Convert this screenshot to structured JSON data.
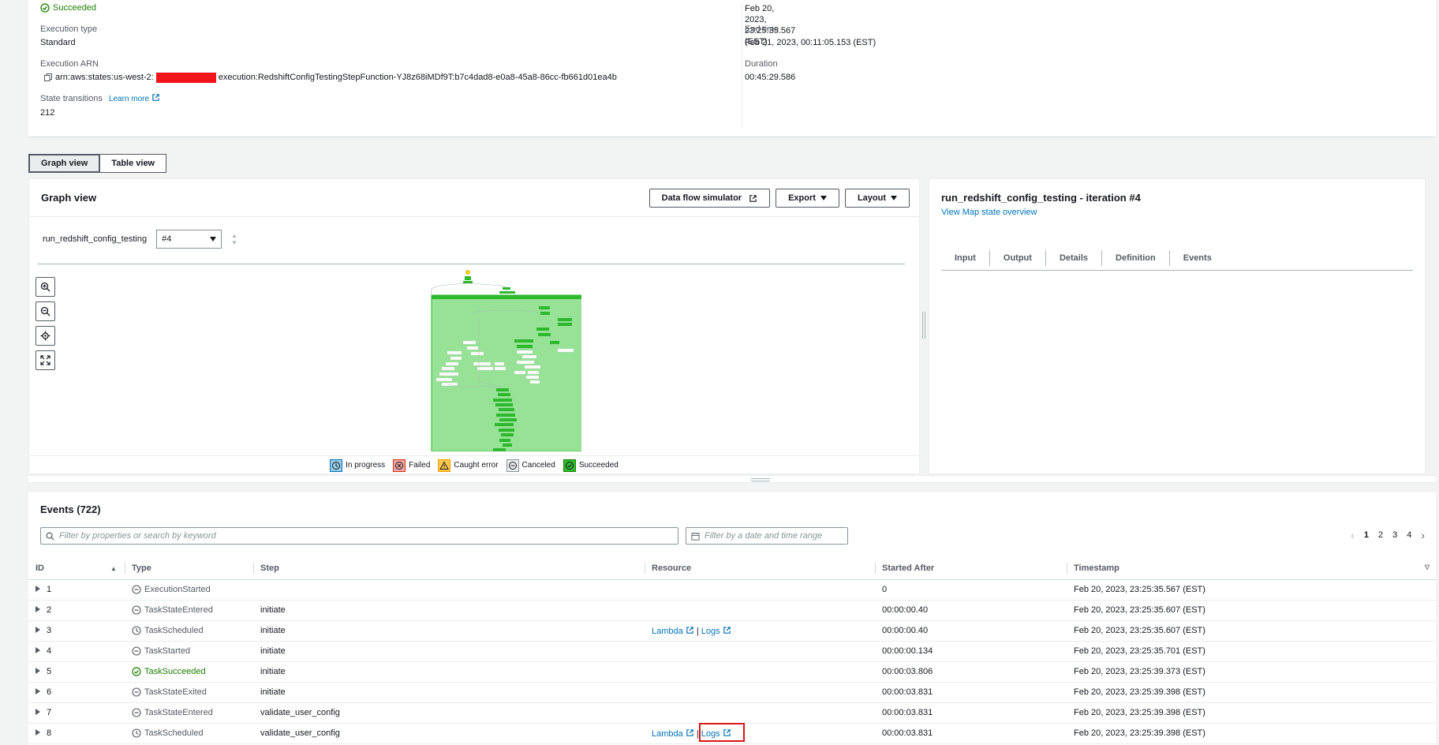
{
  "summary": {
    "status": "Succeeded",
    "start_time": "Feb 20, 2023, 23:25:35.567 (EST)",
    "execution_type_label": "Execution type",
    "execution_type": "Standard",
    "end_time_label": "End time",
    "end_time": "Feb 21, 2023, 00:11:05.153 (EST)",
    "arn_label": "Execution ARN",
    "arn_prefix": "arn:aws:states:us-west-2:",
    "arn_suffix": "execution:RedshiftConfigTestingStepFunction-YJ8z68iMDf9T:b7c4dad8-e0a8-45a8-86cc-fb661d01ea4b",
    "duration_label": "Duration",
    "duration": "00:45:29.586",
    "state_transitions_label": "State transitions",
    "learn_more": "Learn more",
    "state_transitions": "212"
  },
  "view_tabs": [
    "Graph view",
    "Table view"
  ],
  "graph": {
    "title": "Graph view",
    "data_flow_button": "Data flow simulator",
    "export_button": "Export",
    "layout_button": "Layout",
    "map_state_label": "run_redshift_config_testing",
    "iteration_value": "#4",
    "legend": [
      "In progress",
      "Failed",
      "Caught error",
      "Canceled",
      "Succeeded"
    ]
  },
  "detail": {
    "title": "run_redshift_config_testing - iteration #4",
    "link": "View Map state overview",
    "tabs": [
      "Input",
      "Output",
      "Details",
      "Definition",
      "Events"
    ]
  },
  "events": {
    "title": "Events (722)",
    "search_placeholder": "Filter by properties or search by keyword",
    "date_placeholder": "Filter by a date and time range",
    "pages": [
      "1",
      "2",
      "3",
      "4"
    ],
    "columns": [
      "ID",
      "Type",
      "Step",
      "Resource",
      "Started After",
      "Timestamp"
    ],
    "resource_lambda": "Lambda",
    "resource_logs": "Logs",
    "rows": [
      {
        "id": "1",
        "type": "ExecutionStarted",
        "status": "neutral",
        "step": "",
        "resource": false,
        "started_after": "0",
        "timestamp": "Feb 20, 2023, 23:25:35.567 (EST)"
      },
      {
        "id": "2",
        "type": "TaskStateEntered",
        "status": "neutral",
        "step": "initiate",
        "resource": false,
        "started_after": "00:00:00.40",
        "timestamp": "Feb 20, 2023, 23:25:35.607 (EST)"
      },
      {
        "id": "3",
        "type": "TaskScheduled",
        "status": "clock",
        "step": "initiate",
        "resource": true,
        "started_after": "00:00:00.40",
        "timestamp": "Feb 20, 2023, 23:25:35.607 (EST)"
      },
      {
        "id": "4",
        "type": "TaskStarted",
        "status": "neutral",
        "step": "initiate",
        "resource": false,
        "started_after": "00:00:00.134",
        "timestamp": "Feb 20, 2023, 23:25:35.701 (EST)"
      },
      {
        "id": "5",
        "type": "TaskSucceeded",
        "status": "success",
        "step": "initiate",
        "resource": false,
        "started_after": "00:00:03.806",
        "timestamp": "Feb 20, 2023, 23:25:39.373 (EST)"
      },
      {
        "id": "6",
        "type": "TaskStateExited",
        "status": "neutral",
        "step": "initiate",
        "resource": false,
        "started_after": "00:00:03.831",
        "timestamp": "Feb 20, 2023, 23:25:39.398 (EST)"
      },
      {
        "id": "7",
        "type": "TaskStateEntered",
        "status": "neutral",
        "step": "validate_user_config",
        "resource": false,
        "started_after": "00:00:03.831",
        "timestamp": "Feb 20, 2023, 23:25:39.398 (EST)"
      },
      {
        "id": "8",
        "type": "TaskScheduled",
        "status": "clock",
        "step": "validate_user_config",
        "resource": true,
        "started_after": "00:00:03.831",
        "timestamp": "Feb 20, 2023, 23:25:39.398 (EST)"
      }
    ]
  },
  "colors": {
    "success": "#1d8102",
    "link": "#0073bb",
    "graph_fill": "#97e297",
    "node": "#2eb82e",
    "redaction": "#f1141d",
    "highlight": "#d91515"
  }
}
